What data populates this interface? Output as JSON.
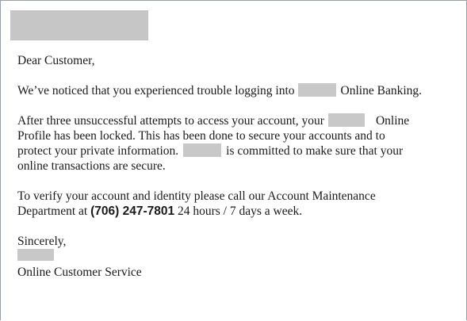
{
  "email": {
    "greeting": "Dear Customer,",
    "p1": {
      "before": "We’ve noticed that you experienced trouble logging into",
      "after": "Online Banking."
    },
    "p2": {
      "line1_before": "After three unsuccessful attempts to access your account, your",
      "line1_after": "Online",
      "line2": "Profile has been locked. This has been done to secure your accounts and to",
      "line3_before": "protect your private information.",
      "line3_after": "is committed to make sure that your",
      "line4": "online transactions are secure."
    },
    "p3": {
      "line1": "To verify your account and identity please call our Account Maintenance",
      "line2_before": "Department at",
      "phone": "(706) 247-7801",
      "line2_after": "24 hours / 7 days a week."
    },
    "closing": "Sincerely,",
    "signature": "Online Customer Service"
  }
}
